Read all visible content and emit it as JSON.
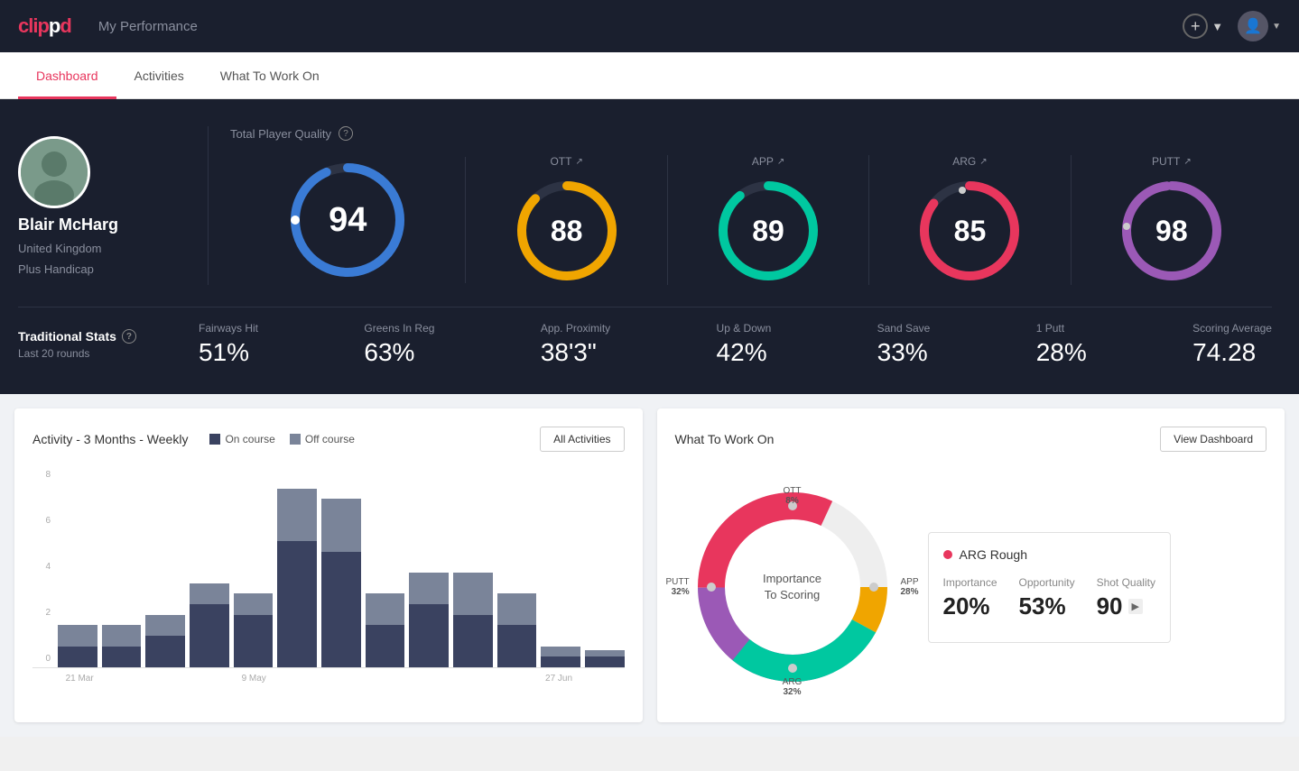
{
  "app": {
    "logo_text": "clippd",
    "header_title": "My Performance",
    "add_btn_label": "▼",
    "avatar_chevron": "▼"
  },
  "nav": {
    "tabs": [
      {
        "id": "dashboard",
        "label": "Dashboard",
        "active": true
      },
      {
        "id": "activities",
        "label": "Activities",
        "active": false
      },
      {
        "id": "what-to-work-on",
        "label": "What To Work On",
        "active": false
      }
    ]
  },
  "player": {
    "name": "Blair McHarg",
    "country": "United Kingdom",
    "handicap": "Plus Handicap"
  },
  "quality": {
    "section_title": "Total Player Quality",
    "main_score": 94,
    "categories": [
      {
        "label": "OTT",
        "score": 88,
        "color": "#f0a500",
        "trend": "↗"
      },
      {
        "label": "APP",
        "score": 89,
        "color": "#00c8a0",
        "trend": "↗"
      },
      {
        "label": "ARG",
        "score": 85,
        "color": "#e8365d",
        "trend": "↗"
      },
      {
        "label": "PUTT",
        "score": 98,
        "color": "#9b59b6",
        "trend": "↗"
      }
    ],
    "main_color": "#3a7bd5"
  },
  "traditional_stats": {
    "label": "Traditional Stats",
    "sub_label": "Last 20 rounds",
    "stats": [
      {
        "label": "Fairways Hit",
        "value": "51%"
      },
      {
        "label": "Greens In Reg",
        "value": "63%"
      },
      {
        "label": "App. Proximity",
        "value": "38'3\""
      },
      {
        "label": "Up & Down",
        "value": "42%"
      },
      {
        "label": "Sand Save",
        "value": "33%"
      },
      {
        "label": "1 Putt",
        "value": "28%"
      },
      {
        "label": "Scoring Average",
        "value": "74.28"
      }
    ]
  },
  "activity_chart": {
    "title": "Activity - 3 Months - Weekly",
    "legend": {
      "on_course": "On course",
      "off_course": "Off course"
    },
    "btn_label": "All Activities",
    "y_labels": [
      "8",
      "6",
      "4",
      "2",
      "0"
    ],
    "x_labels": [
      "21 Mar",
      "",
      "",
      "9 May",
      "",
      "",
      "27 Jun"
    ],
    "bars": [
      {
        "on": 1,
        "off": 1
      },
      {
        "on": 1,
        "off": 1
      },
      {
        "on": 1.5,
        "off": 1
      },
      {
        "on": 3,
        "off": 1
      },
      {
        "on": 2.5,
        "off": 1
      },
      {
        "on": 6,
        "off": 2.5
      },
      {
        "on": 5.5,
        "off": 2.5
      },
      {
        "on": 2,
        "off": 1.5
      },
      {
        "on": 3,
        "off": 1.5
      },
      {
        "on": 2.5,
        "off": 2
      },
      {
        "on": 2,
        "off": 1.5
      },
      {
        "on": 0.5,
        "off": 0.5
      },
      {
        "on": 0.5,
        "off": 0.3
      }
    ]
  },
  "what_to_work_on": {
    "title": "What To Work On",
    "btn_label": "View Dashboard",
    "center_text": "Importance\nTo Scoring",
    "segments": [
      {
        "label": "OTT",
        "value": "8%",
        "color": "#f0a500",
        "pos": "top"
      },
      {
        "label": "APP",
        "value": "28%",
        "color": "#00c8a0",
        "pos": "right"
      },
      {
        "label": "ARG",
        "value": "32%",
        "color": "#e8365d",
        "pos": "bottom"
      },
      {
        "label": "PUTT",
        "value": "32%",
        "color": "#9b59b6",
        "pos": "left"
      }
    ],
    "card": {
      "title": "ARG Rough",
      "importance_label": "Importance",
      "importance_value": "20%",
      "opportunity_label": "Opportunity",
      "opportunity_value": "53%",
      "shot_quality_label": "Shot Quality",
      "shot_quality_value": "90"
    }
  }
}
